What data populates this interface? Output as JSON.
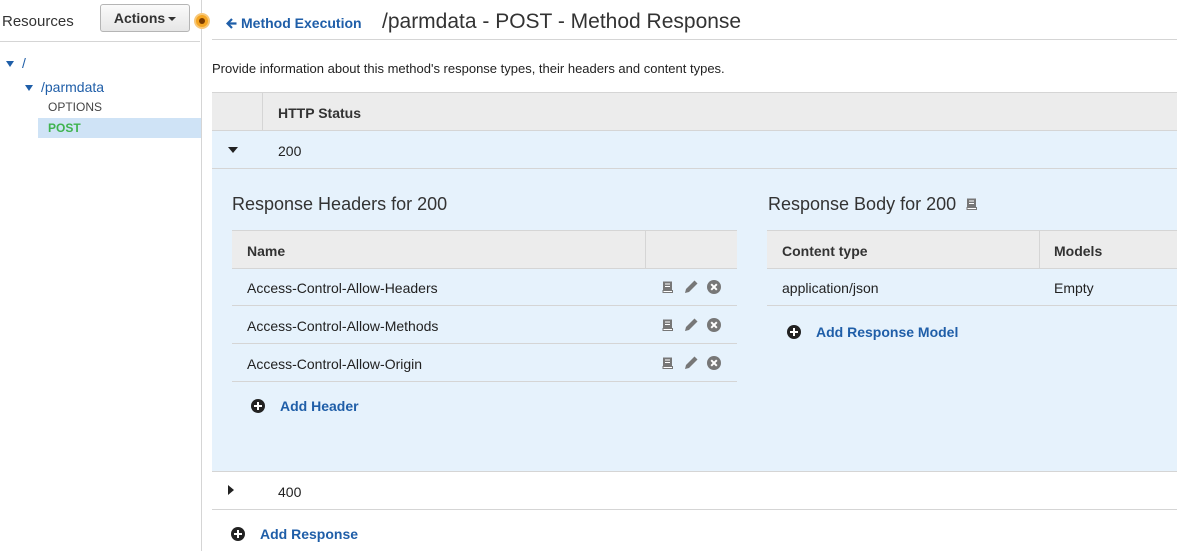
{
  "sidebar": {
    "title": "Resources",
    "actions_label": "Actions",
    "tree": {
      "root": "/",
      "child": "/parmdata",
      "methods": [
        "OPTIONS",
        "POST"
      ],
      "selected_method": "POST"
    }
  },
  "header": {
    "back_label": "Method Execution",
    "title": "/parmdata - POST - Method Response"
  },
  "description": "Provide information about this method's response types, their headers and content types.",
  "status_table": {
    "column": "HTTP Status",
    "rows": [
      {
        "status": "200",
        "expanded": true,
        "headers_title": "Response Headers for 200",
        "headers_column": "Name",
        "headers": [
          "Access-Control-Allow-Headers",
          "Access-Control-Allow-Methods",
          "Access-Control-Allow-Origin"
        ],
        "add_header_label": "Add Header",
        "body_title": "Response Body for 200",
        "body_columns": [
          "Content type",
          "Models"
        ],
        "body_rows": [
          {
            "content_type": "application/json",
            "model": "Empty"
          }
        ],
        "add_model_label": "Add Response Model"
      },
      {
        "status": "400",
        "expanded": false
      }
    ],
    "add_response_label": "Add Response"
  },
  "colors": {
    "link": "#1f5ea8",
    "selected_method": "#3fb34f",
    "expanded_bg": "#e6f2fc",
    "header_bg": "#ececec"
  },
  "icons": [
    "book-icon",
    "pencil-icon",
    "remove-circle-icon",
    "plus-circle-icon",
    "arrow-left-icon"
  ]
}
